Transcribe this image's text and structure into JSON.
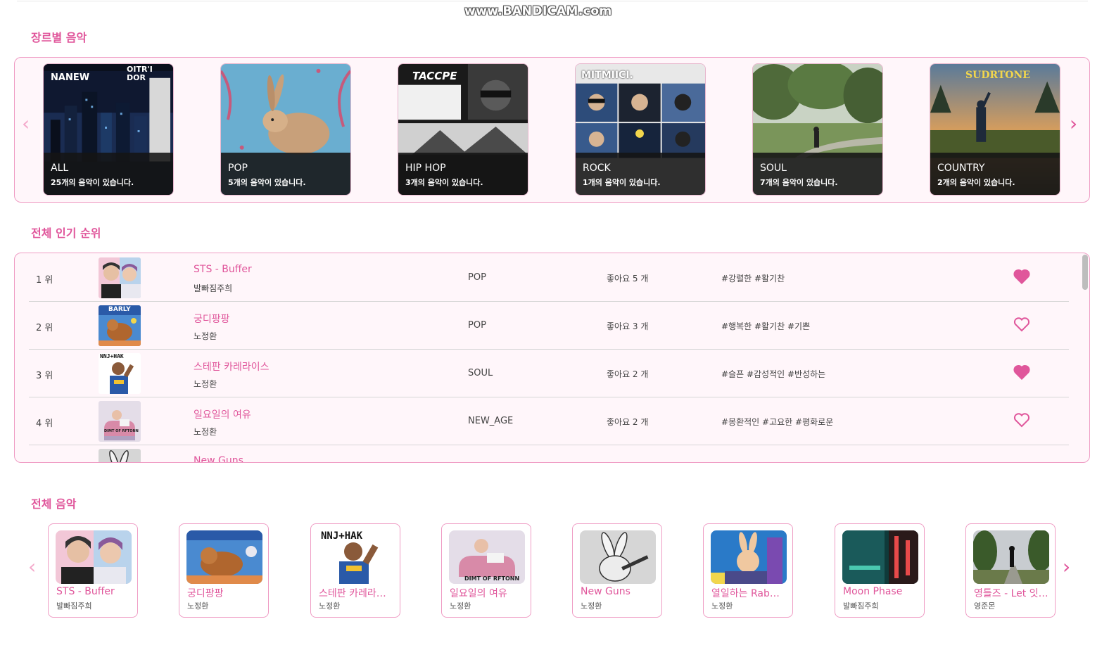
{
  "watermark": "www.BANDICAM.com",
  "sections": {
    "genre_title": "장르별 음악",
    "ranking_title": "전체 인기 순위",
    "all_title": "전체 음악"
  },
  "genres": [
    {
      "name": "ALL",
      "count": "25개의 음악이 있습니다."
    },
    {
      "name": "POP",
      "count": "5개의 음악이 있습니다."
    },
    {
      "name": "HIP HOP",
      "count": "3개의 음악이 있습니다."
    },
    {
      "name": "ROCK",
      "count": "1개의 음악이 있습니다."
    },
    {
      "name": "SOUL",
      "count": "7개의 음악이 있습니다."
    },
    {
      "name": "COUNTRY",
      "count": "2개의 음악이 있습니다."
    }
  ],
  "ranking": [
    {
      "rank": "1 위",
      "title": "STS - Buffer",
      "artist": "발빠짐주희",
      "genre": "POP",
      "likes": "좋아요 5 개",
      "tags": "#강렬한 #활기찬",
      "liked": true
    },
    {
      "rank": "2 위",
      "title": "궁디팡팡",
      "artist": "노정환",
      "genre": "POP",
      "likes": "좋아요 3 개",
      "tags": "#행복한 #활기찬 #기쁜",
      "liked": false
    },
    {
      "rank": "3 위",
      "title": "스테판 카레라이스",
      "artist": "노정환",
      "genre": "SOUL",
      "likes": "좋아요 2 개",
      "tags": "#슬픈 #감성적인 #반성하는",
      "liked": true
    },
    {
      "rank": "4 위",
      "title": "일요일의 여유",
      "artist": "노정환",
      "genre": "NEW_AGE",
      "likes": "좋아요 2 개",
      "tags": "#몽환적인 #고요한 #평화로운",
      "liked": false
    },
    {
      "rank": "",
      "title": "New Guns",
      "artist": "",
      "genre": "",
      "likes": "",
      "tags": "",
      "liked": false
    }
  ],
  "all_music": [
    {
      "title": "STS - Buffer",
      "artist": "발빠짐주희"
    },
    {
      "title": "궁디팡팡",
      "artist": "노정환"
    },
    {
      "title": "스테판 카레라…",
      "artist": "노정환"
    },
    {
      "title": "일요일의 여유",
      "artist": "노정환"
    },
    {
      "title": "New Guns",
      "artist": "노정환"
    },
    {
      "title": "열일하는 Rab…",
      "artist": "노정환"
    },
    {
      "title": "Moon Phase",
      "artist": "발빠짐주희"
    },
    {
      "title": "영틀즈 - Let 잇…",
      "artist": "영준몬"
    }
  ],
  "album_text": {
    "all": [
      "NANEW",
      "OITR'I DOR"
    ],
    "hiphop": "TACCPE",
    "rock": "MITMIICI.",
    "country": "SUDRTONE",
    "pop2": "BARLY",
    "soul_shirt": "NNJ+HAK",
    "newage": "DIMT OF RFTONN"
  },
  "colors": {
    "accent": "#e0569b",
    "panel_border": "#ef9cc4",
    "panel_bg": "#fff6fa",
    "heart": "#e0569b"
  },
  "icons": {
    "prev": "chevron-left-icon",
    "next": "chevron-right-icon",
    "heart_filled": "heart-filled-icon",
    "heart_outline": "heart-outline-icon"
  }
}
